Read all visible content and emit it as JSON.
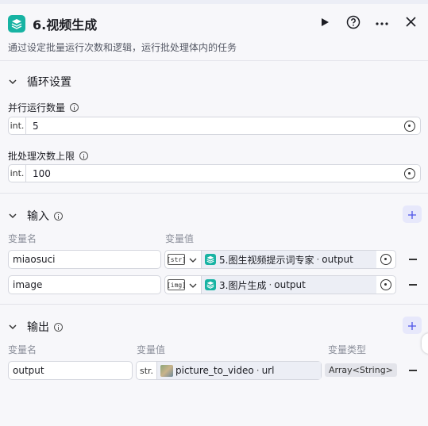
{
  "header": {
    "title": "6.视频生成",
    "description": "通过设定批量运行次数和逻辑，运行批处理体内的任务"
  },
  "loop_settings": {
    "section_title": "循环设置",
    "parallel_label": "并行运行数量",
    "parallel_prefix": "int.",
    "parallel_value": "5",
    "batch_limit_label": "批处理次数上限",
    "batch_limit_prefix": "int.",
    "batch_limit_value": "100"
  },
  "input": {
    "section_title": "输入",
    "col_name": "变量名",
    "col_value": "变量值",
    "rows": [
      {
        "name": "miaosuci",
        "type_tag": "[str]",
        "ref_node": "5.图生视频提示词专家",
        "ref_field": "output"
      },
      {
        "name": "image",
        "type_tag": "[img]",
        "ref_node": "3.图片生成",
        "ref_field": "output"
      }
    ]
  },
  "output": {
    "section_title": "输出",
    "col_name": "变量名",
    "col_value": "变量值",
    "col_type": "变量类型",
    "rows": [
      {
        "name": "output",
        "type_prefix": "str.",
        "ref_node": "picture_to_video",
        "ref_field": "url",
        "var_type": "Array<String>"
      }
    ]
  },
  "colors": {
    "accent": "#4d53e8",
    "node_icon": "#17b3a3"
  }
}
